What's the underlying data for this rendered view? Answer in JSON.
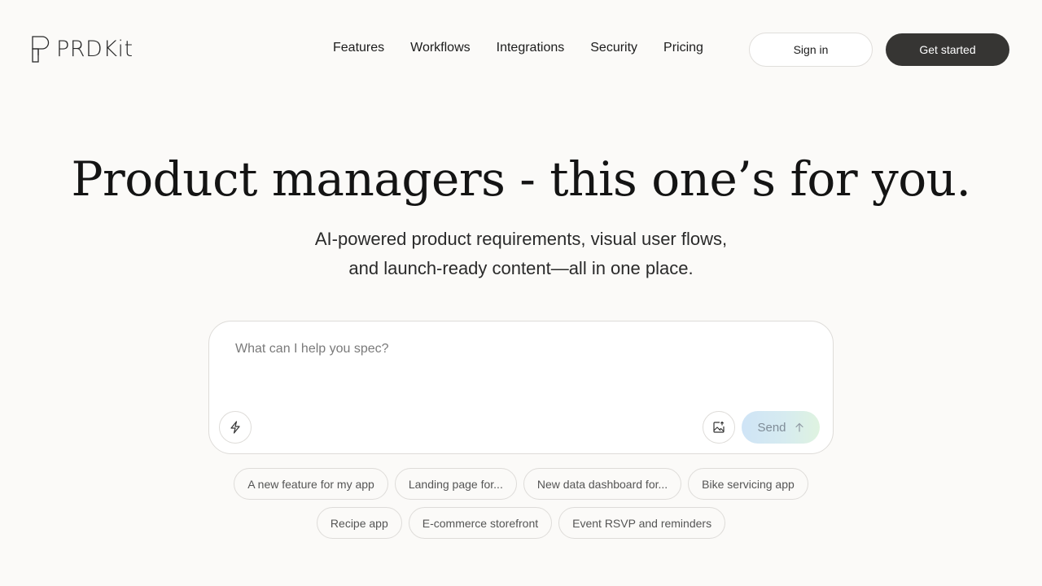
{
  "brand": {
    "name": "PRDKit",
    "logo_icon": "p-logo-mark"
  },
  "nav": {
    "links": [
      "Features",
      "Workflows",
      "Integrations",
      "Security",
      "Pricing"
    ]
  },
  "header": {
    "sign_in_label": "Sign in",
    "get_started_label": "Get started"
  },
  "hero": {
    "title": "Product managers - this one’s for you.",
    "subtitle_line1": "AI-powered product requirements, visual user flows,",
    "subtitle_line2": "and launch-ready content—all in one place."
  },
  "prompt": {
    "placeholder": "What can I help you spec?",
    "value": "",
    "send_label": "Send",
    "icons": {
      "left": "lightning-bolt-icon",
      "attach": "image-upload-icon",
      "send": "arrow-up-icon"
    }
  },
  "suggestions": {
    "row1": [
      "A new feature for my app",
      "Landing page for...",
      "New data dashboard for...",
      "Bike servicing app"
    ],
    "row2": [
      "Recipe app",
      "E-commerce storefront",
      "Event RSVP and reminders"
    ]
  },
  "colors": {
    "background": "#fbfaf8",
    "primary_button": "#363533",
    "send_gradient_start": "#cfe4f6",
    "send_gradient_end": "#dff3e0"
  }
}
